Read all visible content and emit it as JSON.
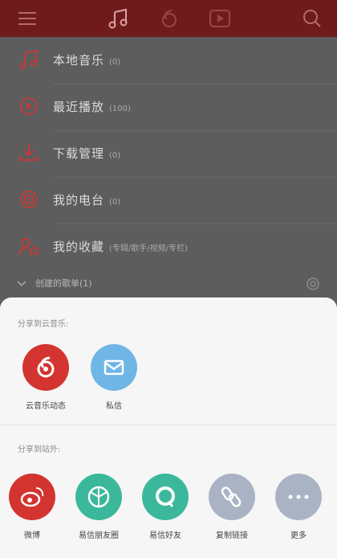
{
  "colors": {
    "topbar": "#6f1b1b",
    "overlay": "#5d5d5d",
    "accent_red": "#d3342f",
    "mail_blue": "#6fb6e6",
    "teal": "#3bb89b",
    "gray_link": "#a9b3c4"
  },
  "topbar": {
    "icons": [
      "menu-icon",
      "music-note-icon",
      "netease-logo-icon",
      "video-play-icon",
      "search-icon"
    ]
  },
  "menu": {
    "items": [
      {
        "icon": "music-note-icon",
        "label": "本地音乐",
        "count": "(0)"
      },
      {
        "icon": "recent-play-icon",
        "label": "最近播放",
        "count": "(100)"
      },
      {
        "icon": "download-icon",
        "label": "下载管理",
        "count": "(0)"
      },
      {
        "icon": "radio-icon",
        "label": "我的电台",
        "count": "(0)"
      },
      {
        "icon": "favorites-icon",
        "label": "我的收藏",
        "count": "(专辑/歌手/视频/专栏)"
      }
    ]
  },
  "group": {
    "label": "创建的歌单(1)"
  },
  "share": {
    "section1_title": "分享到云音乐:",
    "section1_items": [
      {
        "icon": "netease-logo-icon",
        "label": "云音乐动态"
      },
      {
        "icon": "mail-icon",
        "label": "私信"
      }
    ],
    "section2_title": "分享到站外:",
    "section2_items": [
      {
        "icon": "weibo-icon",
        "label": "微博"
      },
      {
        "icon": "yixin-moments-icon",
        "label": "易信朋友圈"
      },
      {
        "icon": "yixin-friends-icon",
        "label": "易信好友"
      },
      {
        "icon": "link-icon",
        "label": "复制链接"
      },
      {
        "icon": "more-icon",
        "label": "更多"
      }
    ]
  }
}
